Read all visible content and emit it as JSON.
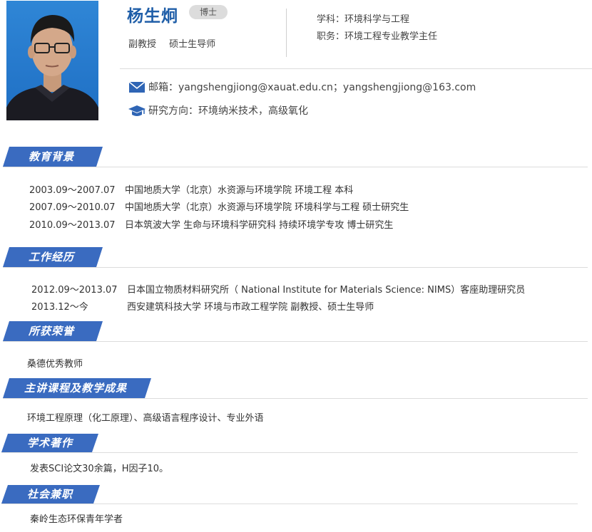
{
  "profile": {
    "name": "杨生炯",
    "degree": "博士",
    "titles": [
      "副教授",
      "硕士生导师"
    ],
    "discipline": "学科：环境科学与工程",
    "position": "职务：环境工程专业教学主任",
    "email": "邮箱：yangshengjiong@xauat.edu.cn；yangshengjiong@163.com",
    "research": "研究方向：环境纳米技术，高级氧化"
  },
  "sections": {
    "education": {
      "title": "教育背景",
      "rows": [
        {
          "date": "2003.09～2007.07",
          "text": "中国地质大学（北京）水资源与环境学院 环境工程 本科"
        },
        {
          "date": "2007.09～2010.07",
          "text": "中国地质大学（北京）水资源与环境学院 环境科学与工程 硕士研究生"
        },
        {
          "date": "2010.09～2013.07",
          "text": "日本筑波大学 生命与环境科学研究科 持续环境学专攻 博士研究生"
        }
      ]
    },
    "work": {
      "title": "工作经历",
      "rows": [
        {
          "date": "2012.09～2013.07",
          "text": "日本国立物质材料研究所（ National Institute for Materials Science: NIMS）客座助理研究员"
        },
        {
          "date": "2013.12～今",
          "text": "西安建筑科技大学 环境与市政工程学院 副教授、硕士生导师"
        }
      ]
    },
    "honors": {
      "title": "所获荣誉",
      "text": "桑德优秀教师"
    },
    "courses": {
      "title": "主讲课程及教学成果",
      "text": "环境工程原理（化工原理）、高级语言程序设计、专业外语"
    },
    "publications": {
      "title": "学术著作",
      "text": "发表SCI论文30余篇，H因子10。"
    },
    "service": {
      "title": "社会兼职",
      "text": "秦岭生态环保青年学者"
    }
  },
  "colors": {
    "accent": "#3a6bc0",
    "name": "#1f5ea8",
    "badge": "#dcdcdc"
  },
  "icons": {
    "email": "envelope-icon",
    "research": "graduation-cap-icon"
  }
}
